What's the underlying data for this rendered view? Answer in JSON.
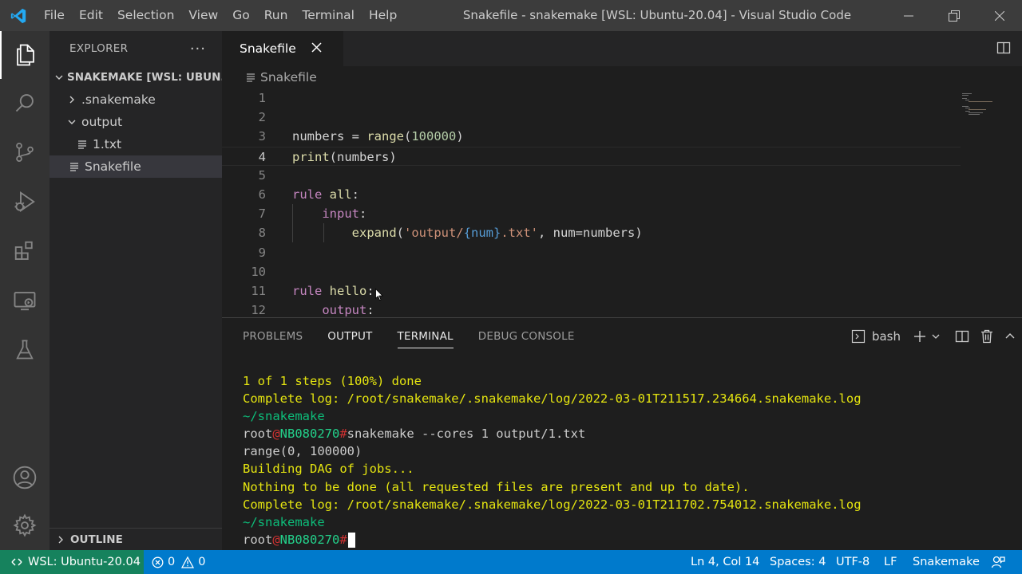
{
  "window": {
    "title": "Snakefile - snakemake [WSL: Ubuntu-20.04] - Visual Studio Code",
    "menu": [
      "File",
      "Edit",
      "Selection",
      "View",
      "Go",
      "Run",
      "Terminal",
      "Help"
    ]
  },
  "activity_bar": [
    "files-icon",
    "search-icon",
    "source-control-icon",
    "run-debug-icon",
    "extensions-icon",
    "remote-explorer-icon",
    "testing-icon",
    "account-icon",
    "settings-gear-icon"
  ],
  "sidebar": {
    "title": "EXPLORER",
    "more": "···",
    "folder": "SNAKEMAKE [WSL: UBUN...",
    "tree": [
      {
        "label": ".snakemake",
        "kind": "folder",
        "expanded": false
      },
      {
        "label": "output",
        "kind": "folder",
        "expanded": true
      },
      {
        "label": "1.txt",
        "kind": "file"
      },
      {
        "label": "Snakefile",
        "kind": "file",
        "selected": true
      }
    ],
    "outline": "OUTLINE"
  },
  "editor": {
    "tab_label": "Snakefile",
    "breadcrumb": "Snakefile",
    "current_line": 4,
    "lines": [
      {
        "n": "1",
        "tokens": []
      },
      {
        "n": "2",
        "tokens": []
      },
      {
        "n": "3",
        "tokens": [
          {
            "t": "numbers = ",
            "c": "#d4d4d4"
          },
          {
            "t": "range",
            "c": "#dcdcaa"
          },
          {
            "t": "(",
            "c": "#d4d4d4"
          },
          {
            "t": "100000",
            "c": "#b5cea8"
          },
          {
            "t": ")",
            "c": "#d4d4d4"
          }
        ]
      },
      {
        "n": "4",
        "tokens": [
          {
            "t": "print",
            "c": "#dcdcaa"
          },
          {
            "t": "(numbers)",
            "c": "#d4d4d4"
          }
        ]
      },
      {
        "n": "5",
        "tokens": []
      },
      {
        "n": "6",
        "tokens": [
          {
            "t": "rule",
            "c": "#c586c0"
          },
          {
            "t": " ",
            "c": "#d4d4d4"
          },
          {
            "t": "all",
            "c": "#dcdcaa"
          },
          {
            "t": ":",
            "c": "#d4d4d4"
          }
        ]
      },
      {
        "n": "7",
        "tokens": [
          {
            "t": "    ",
            "c": "#d4d4d4"
          },
          {
            "t": "input",
            "c": "#c586c0"
          },
          {
            "t": ":",
            "c": "#d4d4d4"
          }
        ]
      },
      {
        "n": "8",
        "tokens": [
          {
            "t": "        ",
            "c": "#d4d4d4"
          },
          {
            "t": "expand",
            "c": "#dcdcaa"
          },
          {
            "t": "(",
            "c": "#d4d4d4"
          },
          {
            "t": "'output/",
            "c": "#ce9178"
          },
          {
            "t": "{num}",
            "c": "#569cd6"
          },
          {
            "t": ".txt'",
            "c": "#ce9178"
          },
          {
            "t": ", num=numbers)",
            "c": "#d4d4d4"
          }
        ]
      },
      {
        "n": "9",
        "tokens": []
      },
      {
        "n": "10",
        "tokens": []
      },
      {
        "n": "11",
        "tokens": [
          {
            "t": "rule",
            "c": "#c586c0"
          },
          {
            "t": " ",
            "c": "#d4d4d4"
          },
          {
            "t": "hello",
            "c": "#dcdcaa"
          },
          {
            "t": ":",
            "c": "#d4d4d4"
          }
        ]
      },
      {
        "n": "12",
        "tokens": [
          {
            "t": "    ",
            "c": "#d4d4d4"
          },
          {
            "t": "output",
            "c": "#c586c0"
          },
          {
            "t": ":",
            "c": "#d4d4d4"
          }
        ]
      }
    ]
  },
  "panel": {
    "tabs": [
      "PROBLEMS",
      "OUTPUT",
      "TERMINAL",
      "DEBUG CONSOLE"
    ],
    "active_tab": "TERMINAL",
    "shell": "bash",
    "terminal_lines": [
      [
        {
          "t": "1 of 1 steps (100%) done",
          "c": "t-yellow"
        }
      ],
      [
        {
          "t": "Complete log: /root/snakemake/.snakemake/log/2022-03-01T211517.234664.snakemake.log",
          "c": "t-yellow"
        }
      ],
      [
        {
          "t": "~/snakemake",
          "c": "t-green"
        }
      ],
      [
        {
          "t": "root",
          "c": ""
        },
        {
          "t": "@",
          "c": "t-red"
        },
        {
          "t": "NB080270",
          "c": "t-cyan"
        },
        {
          "t": "#",
          "c": "t-red"
        },
        {
          "t": "snakemake --cores 1 output/1.txt",
          "c": ""
        }
      ],
      [
        {
          "t": "range(0, 100000)",
          "c": ""
        }
      ],
      [
        {
          "t": "Building DAG of jobs...",
          "c": "t-yellow"
        }
      ],
      [
        {
          "t": "Nothing to be done (all requested files are present and up to date).",
          "c": "t-yellow"
        }
      ],
      [
        {
          "t": "Complete log: /root/snakemake/.snakemake/log/2022-03-01T211702.754012.snakemake.log",
          "c": "t-yellow"
        }
      ],
      [
        {
          "t": "~/snakemake",
          "c": "t-green"
        }
      ],
      [
        {
          "t": "root",
          "c": ""
        },
        {
          "t": "@",
          "c": "t-red"
        },
        {
          "t": "NB080270",
          "c": "t-cyan"
        },
        {
          "t": "#",
          "c": "t-red"
        }
      ]
    ]
  },
  "status_bar": {
    "remote": "WSL: Ubuntu-20.04",
    "errors": "0",
    "warnings": "0",
    "position": "Ln 4, Col 14",
    "spaces": "Spaces: 4",
    "encoding": "UTF-8",
    "eol": "LF",
    "language": "Snakemake"
  },
  "colors": {
    "statusbar": "#007acc",
    "remote": "#16825d",
    "titlebar": "#3c3c3c",
    "activitybar": "#333333",
    "sidebar": "#252526",
    "editor": "#1e1e1e"
  }
}
